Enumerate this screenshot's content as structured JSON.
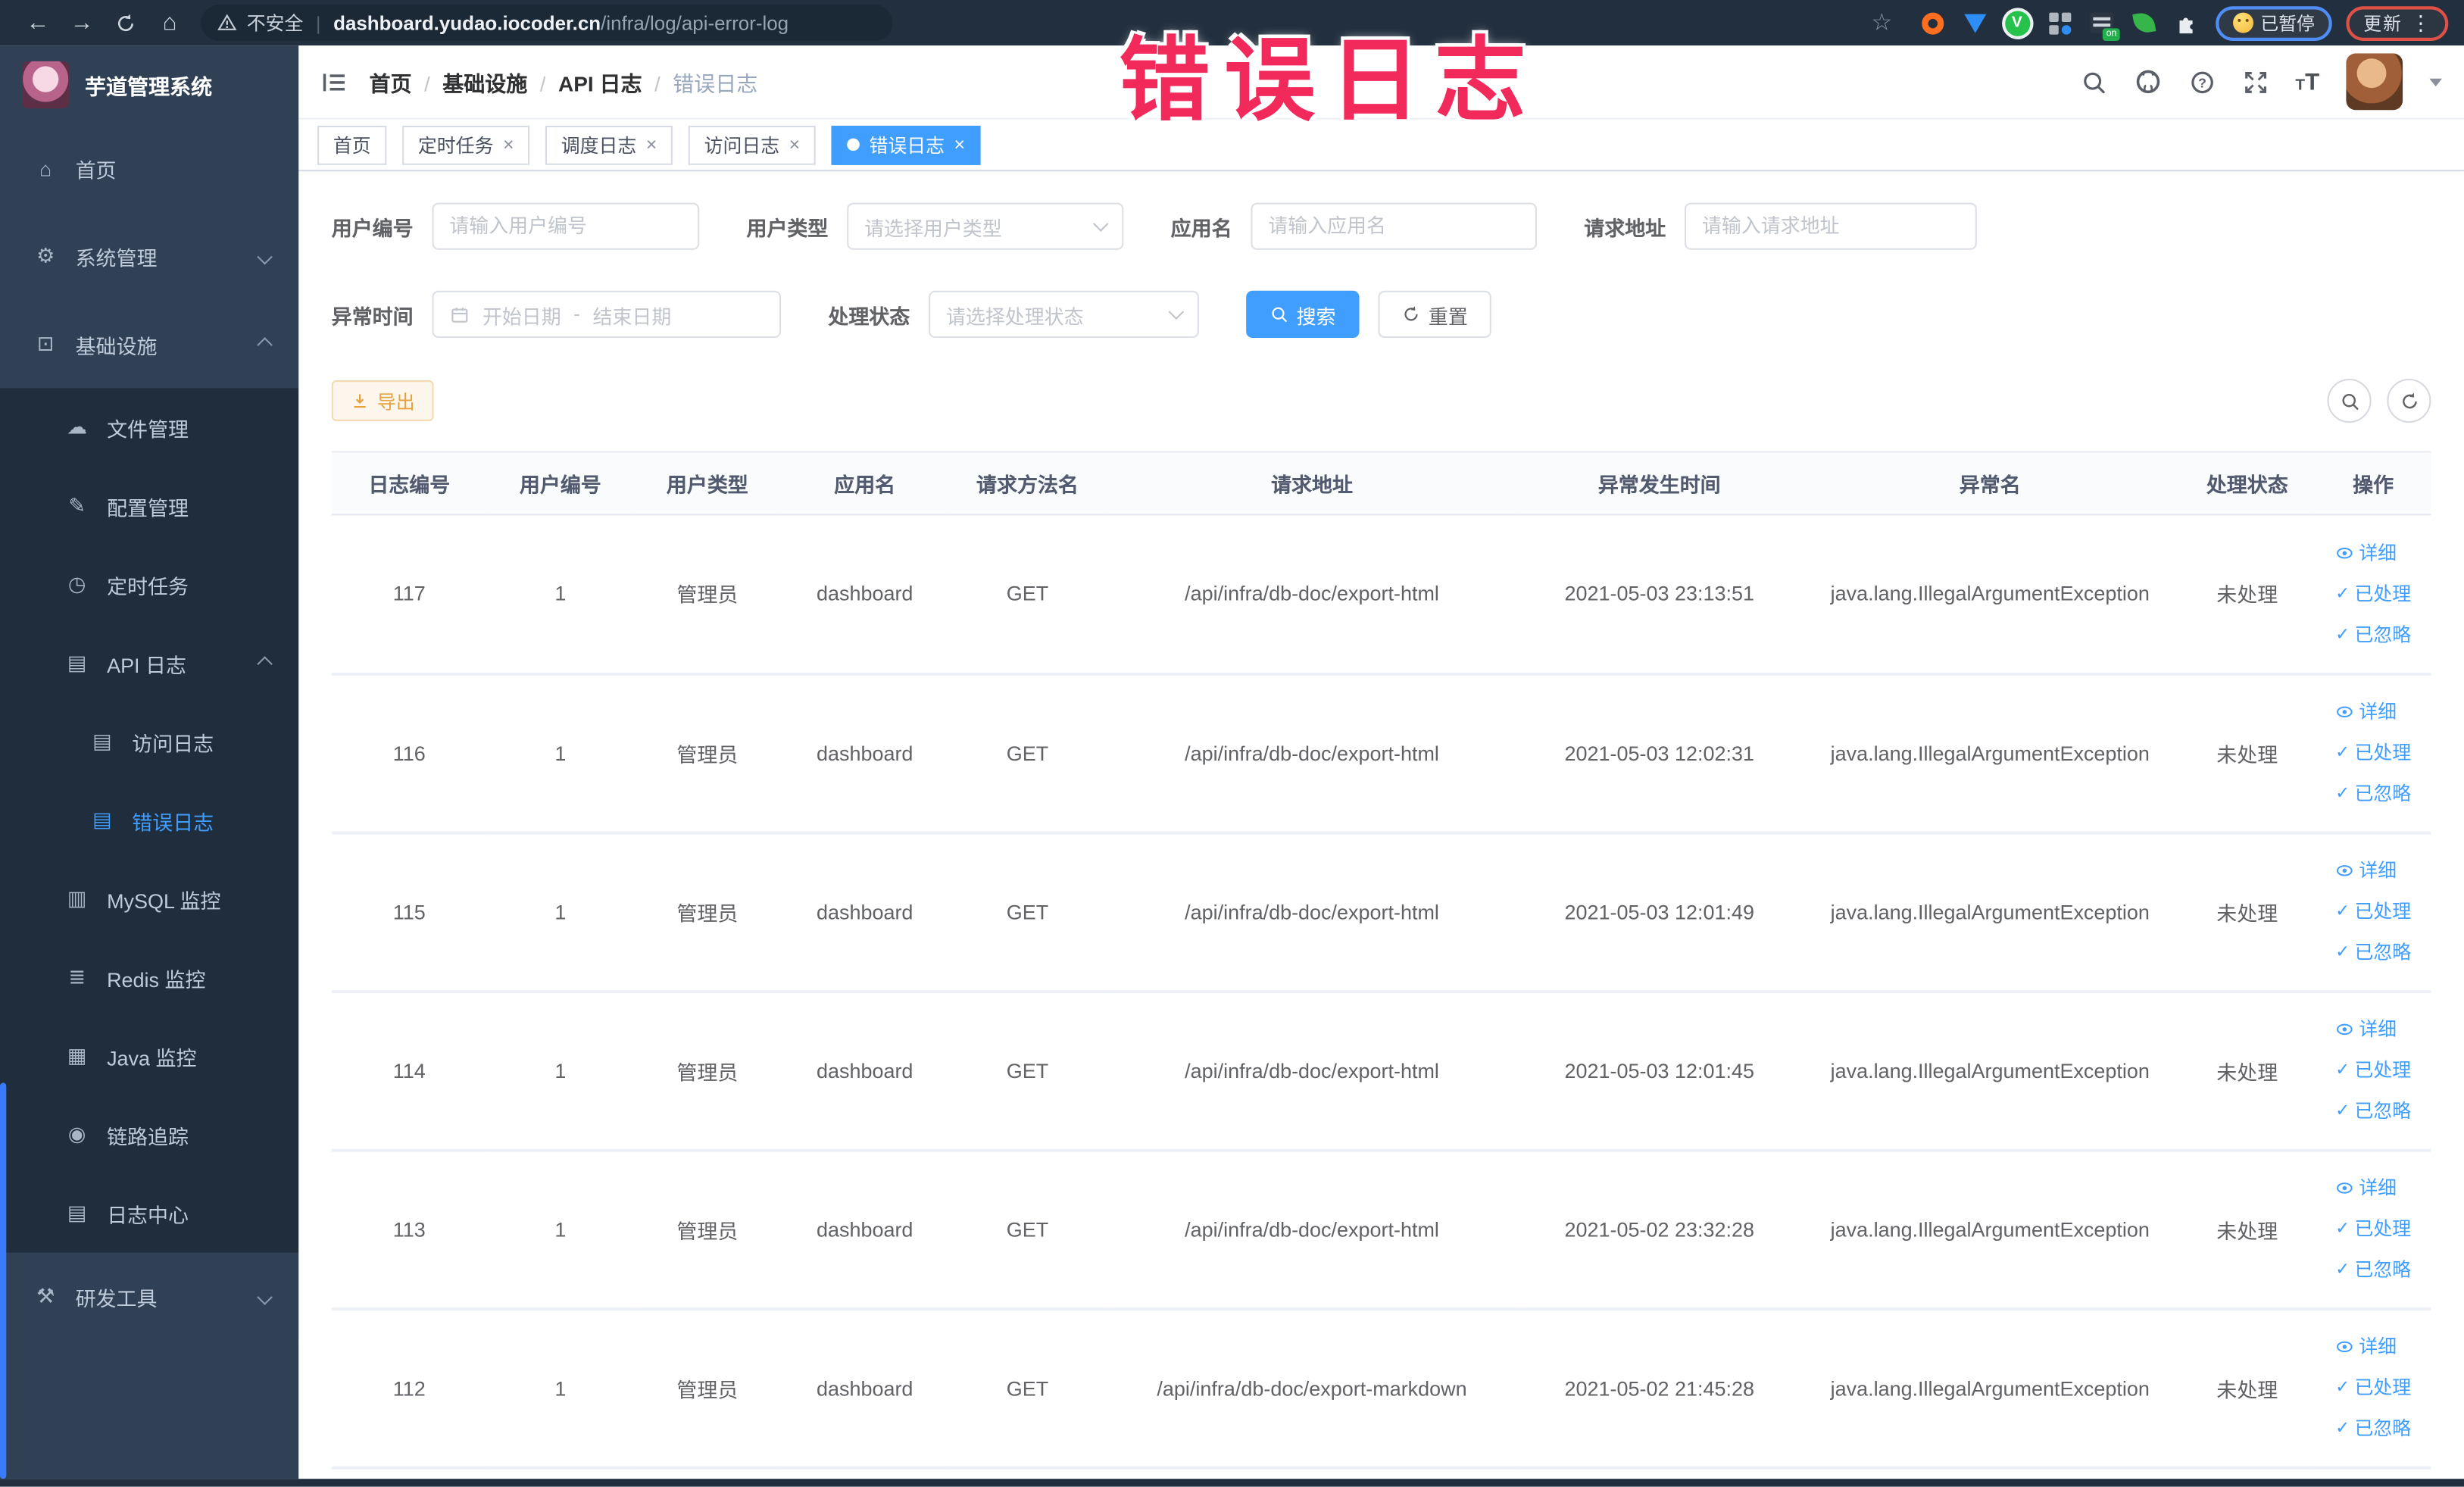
{
  "watermark": {
    "text": "错误日志"
  },
  "browser": {
    "security_label": "不安全",
    "url_host": "dashboard.yudao.iocoder.cn",
    "url_path": "/infra/log/api-error-log",
    "paused_chip": "已暂停",
    "update_chip": "更新"
  },
  "sidebar": {
    "title": "芋道管理系统",
    "items": [
      {
        "label": "首页",
        "icon": "home",
        "depth": 0
      },
      {
        "label": "系统管理",
        "icon": "gear",
        "depth": 0,
        "arrow": "down"
      },
      {
        "label": "基础设施",
        "icon": "monitor",
        "depth": 0,
        "arrow": "up"
      },
      {
        "label": "文件管理",
        "icon": "cloud",
        "depth": 1
      },
      {
        "label": "配置管理",
        "icon": "edit",
        "depth": 1
      },
      {
        "label": "定时任务",
        "icon": "clock",
        "depth": 1
      },
      {
        "label": "API 日志",
        "icon": "log",
        "depth": 1,
        "arrow": "up"
      },
      {
        "label": "访问日志",
        "icon": "log",
        "depth": 2
      },
      {
        "label": "错误日志",
        "icon": "log",
        "depth": 2,
        "active": true
      },
      {
        "label": "MySQL 监控",
        "icon": "chart",
        "depth": 1
      },
      {
        "label": "Redis 监控",
        "icon": "layers",
        "depth": 1
      },
      {
        "label": "Java 监控",
        "icon": "screen",
        "depth": 1
      },
      {
        "label": "链路追踪",
        "icon": "eye",
        "depth": 1
      },
      {
        "label": "日志中心",
        "icon": "log",
        "depth": 1
      },
      {
        "label": "研发工具",
        "icon": "tool",
        "depth": 0,
        "arrow": "down"
      }
    ]
  },
  "navbar": {
    "breadcrumb": [
      "首页",
      "基础设施",
      "API 日志",
      "错误日志"
    ]
  },
  "tags": [
    {
      "label": "首页",
      "closable": false,
      "active": false
    },
    {
      "label": "定时任务",
      "closable": true,
      "active": false
    },
    {
      "label": "调度日志",
      "closable": true,
      "active": false
    },
    {
      "label": "访问日志",
      "closable": true,
      "active": false
    },
    {
      "label": "错误日志",
      "closable": true,
      "active": true
    }
  ],
  "filters": {
    "user_id": {
      "label": "用户编号",
      "placeholder": "请输入用户编号"
    },
    "user_type": {
      "label": "用户类型",
      "placeholder": "请选择用户类型"
    },
    "app_name": {
      "label": "应用名",
      "placeholder": "请输入应用名"
    },
    "request_url": {
      "label": "请求地址",
      "placeholder": "请输入请求地址"
    },
    "exception_time": {
      "label": "异常时间",
      "start_placeholder": "开始日期",
      "separator": "-",
      "end_placeholder": "结束日期"
    },
    "process_status": {
      "label": "处理状态",
      "placeholder": "请选择处理状态"
    },
    "search_button": "搜索",
    "reset_button": "重置"
  },
  "toolbar": {
    "export_button": "导出"
  },
  "table": {
    "columns": [
      "日志编号",
      "用户编号",
      "用户类型",
      "应用名",
      "请求方法名",
      "请求地址",
      "异常发生时间",
      "异常名",
      "处理状态",
      "操作"
    ],
    "row_actions": [
      {
        "label": "详细",
        "icon": "eye"
      },
      {
        "label": "已处理",
        "icon": "check"
      },
      {
        "label": "已忽略",
        "icon": "check"
      }
    ],
    "rows": [
      [
        "117",
        "1",
        "管理员",
        "dashboard",
        "GET",
        "/api/infra/db-doc/export-html",
        "2021-05-03 23:13:51",
        "java.lang.IllegalArgumentException",
        "未处理"
      ],
      [
        "116",
        "1",
        "管理员",
        "dashboard",
        "GET",
        "/api/infra/db-doc/export-html",
        "2021-05-03 12:02:31",
        "java.lang.IllegalArgumentException",
        "未处理"
      ],
      [
        "115",
        "1",
        "管理员",
        "dashboard",
        "GET",
        "/api/infra/db-doc/export-html",
        "2021-05-03 12:01:49",
        "java.lang.IllegalArgumentException",
        "未处理"
      ],
      [
        "114",
        "1",
        "管理员",
        "dashboard",
        "GET",
        "/api/infra/db-doc/export-html",
        "2021-05-03 12:01:45",
        "java.lang.IllegalArgumentException",
        "未处理"
      ],
      [
        "113",
        "1",
        "管理员",
        "dashboard",
        "GET",
        "/api/infra/db-doc/export-html",
        "2021-05-02 23:32:28",
        "java.lang.IllegalArgumentException",
        "未处理"
      ],
      [
        "112",
        "1",
        "管理员",
        "dashboard",
        "GET",
        "/api/infra/db-doc/export-markdown",
        "2021-05-02 21:45:28",
        "java.lang.IllegalArgumentException",
        "未处理"
      ]
    ]
  },
  "colors": {
    "primary": "#409eff",
    "warning": "#e6a23c",
    "watermark_pink": "#f2295b",
    "sidebar_bg": "#304156",
    "submenu_bg": "#1f2d3d"
  }
}
